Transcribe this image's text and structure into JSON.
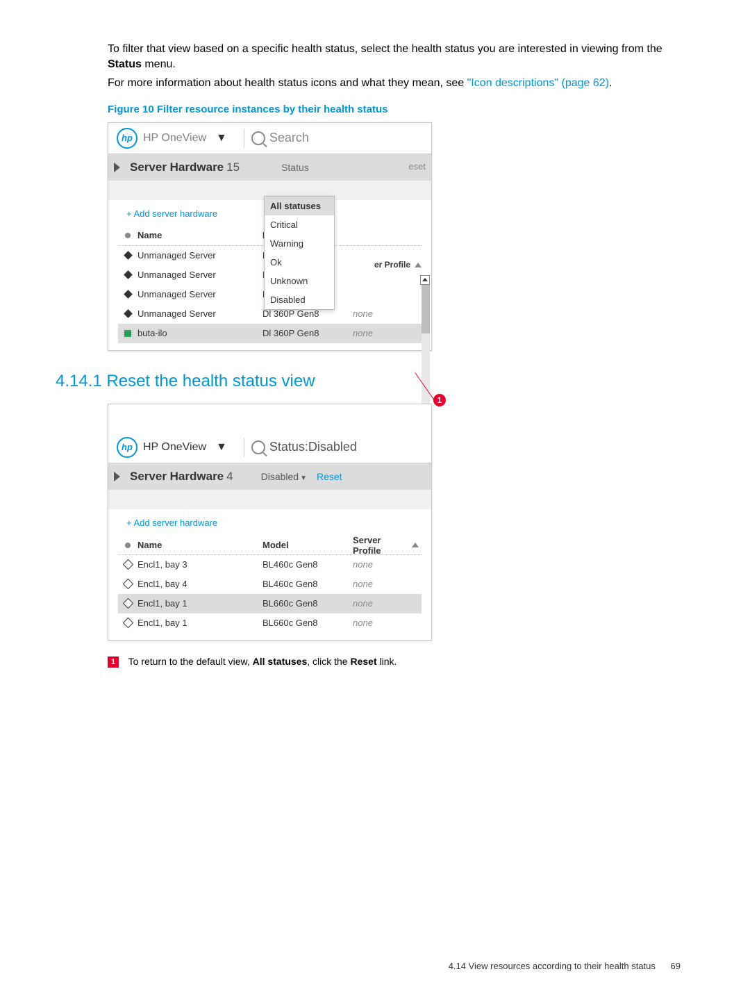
{
  "intro": {
    "p1_a": "To filter that view based on a specific health status, select the health status you are interested in viewing from the ",
    "p1_bold": "Status",
    "p1_b": " menu.",
    "p2_a": "For more information about health status icons and what they mean, see ",
    "p2_link": "\"Icon descriptions\" (page 62)",
    "p2_b": "."
  },
  "figure_caption": "Figure 10 Filter resource instances by their health status",
  "fig1": {
    "app": "HP OneView",
    "search": "Search",
    "title": "Server Hardware",
    "count": "15",
    "status_label": "Status",
    "reset_frag": "eset",
    "add_link": "+ Add server hardware",
    "cols": {
      "name": "Name",
      "model_short": "Mo",
      "profile_frag": "er Profile"
    },
    "dropdown": [
      "All statuses",
      "Critical",
      "Warning",
      "Ok",
      "Unknown",
      "Disabled"
    ],
    "rows": [
      {
        "name": "Unmanaged Server",
        "model": "Dl",
        "profile": ""
      },
      {
        "name": "Unmanaged Server",
        "model": "Dl",
        "profile": ""
      },
      {
        "name": "Unmanaged Server",
        "model": "Dl",
        "profile": ""
      },
      {
        "name": "Unmanaged Server",
        "model": "Dl 360P Gen8",
        "profile": "none"
      },
      {
        "name": "buta-ilo",
        "model": "Dl 360P Gen8",
        "profile": "none"
      }
    ]
  },
  "section_heading": "4.14.1 Reset the health status view",
  "callout_num": "1",
  "fig2": {
    "app": "HP OneView",
    "search": "Status:Disabled",
    "title": "Server Hardware",
    "count": "4",
    "filter": "Disabled",
    "reset": "Reset",
    "add_link": "+ Add server hardware",
    "cols": {
      "name": "Name",
      "model": "Model",
      "profile": "Server Profile"
    },
    "rows": [
      {
        "name": "Encl1, bay 3",
        "model": "BL460c Gen8",
        "profile": "none"
      },
      {
        "name": "Encl1, bay 4",
        "model": "BL460c Gen8",
        "profile": "none"
      },
      {
        "name": "Encl1, bay 1",
        "model": "BL660c Gen8",
        "profile": "none",
        "selected": true
      },
      {
        "name": "Encl1, bay 1",
        "model": "BL660c Gen8",
        "profile": "none"
      }
    ]
  },
  "note": {
    "num": "1",
    "a": "To return to the default view, ",
    "bold1": "All statuses",
    "b": ", click the ",
    "bold2": "Reset",
    "c": " link."
  },
  "footer": {
    "section": "4.14 View resources according to their health status",
    "page": "69"
  }
}
